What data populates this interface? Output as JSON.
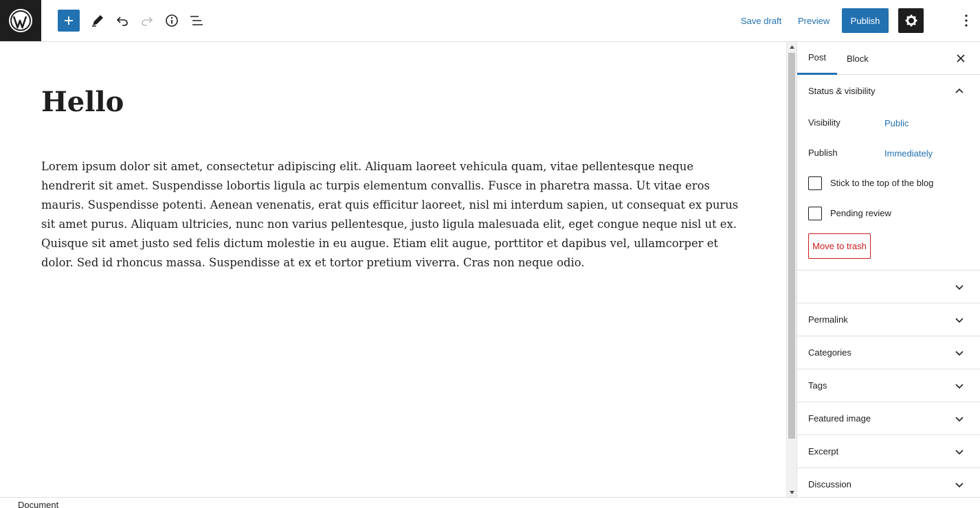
{
  "toolbar": {
    "save_draft": "Save draft",
    "preview": "Preview",
    "publish": "Publish"
  },
  "editor": {
    "title": "Hello",
    "body": "Lorem ipsum dolor sit amet, consectetur adipiscing elit. Aliquam laoreet vehicula quam, vitae pellentesque neque hendrerit sit amet. Suspendisse lobortis ligula ac turpis elementum convallis. Fusce in pharetra massa. Ut vitae eros mauris. Suspendisse potenti. Aenean venenatis, erat quis efficitur laoreet, nisl mi interdum sapien, ut consequat ex purus sit amet purus. Aliquam ultricies, nunc non varius pellentesque, justo ligula malesuada elit, eget congue neque nisl ut ex. Quisque sit amet justo sed felis dictum molestie in eu augue. Etiam elit augue, porttitor et dapibus vel, ullamcorper et dolor. Sed id rhoncus massa. Suspendisse at ex et tortor pretium viverra. Cras non neque odio."
  },
  "sidebar": {
    "tabs": {
      "post": "Post",
      "block": "Block"
    },
    "status": {
      "header": "Status & visibility",
      "visibility_label": "Visibility",
      "visibility_value": "Public",
      "publish_label": "Publish",
      "publish_value": "Immediately",
      "sticky_label": "Stick to the top of the blog",
      "pending_label": "Pending review",
      "trash_label": "Move to trash"
    },
    "panels": {
      "empty": "",
      "permalink": "Permalink",
      "categories": "Categories",
      "tags": "Tags",
      "featured_image": "Featured image",
      "excerpt": "Excerpt",
      "discussion": "Discussion"
    }
  },
  "footer": {
    "breadcrumb": "Document"
  },
  "colors": {
    "accent": "#2271b1",
    "dark": "#1e1e1e",
    "danger": "#cc1818"
  }
}
